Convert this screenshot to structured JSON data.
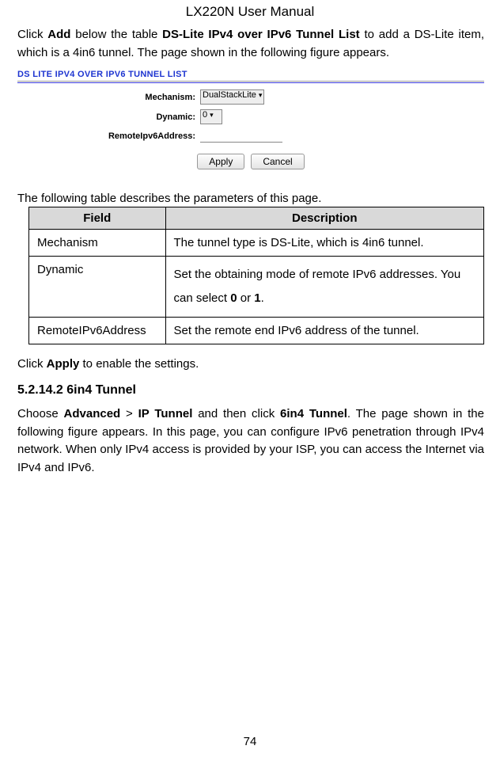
{
  "title": "LX220N User Manual",
  "intro": {
    "part1": "Click ",
    "bold1": "Add",
    "part2": " below the table ",
    "bold2": "DS-Lite IPv4 over IPv6 Tunnel List",
    "part3": " to add a DS-Lite item, which is a 4in6 tunnel. The page shown in the following figure appears."
  },
  "screenshot": {
    "header": "DS LITE IPV4 OVER IPV6 TUNNEL LIST",
    "labels": {
      "mechanism": "Mechanism:",
      "dynamic": "Dynamic:",
      "remote": "RemoteIpv6Address:"
    },
    "values": {
      "mechanism": "DualStackLite",
      "dynamic": "0"
    },
    "buttons": {
      "apply": "Apply",
      "cancel": "Cancel"
    }
  },
  "param_intro": "The following table describes the parameters of this page.",
  "param_headers": {
    "field": "Field",
    "description": "Description"
  },
  "param_rows": {
    "r1_field": "Mechanism",
    "r1_desc": "The tunnel type is DS-Lite, which is 4in6 tunnel.",
    "r2_field": "Dynamic",
    "r2_desc_p1": "Set the obtaining mode of remote IPv6 addresses. You can select ",
    "r2_desc_b1": "0",
    "r2_desc_p2": " or ",
    "r2_desc_b2": "1",
    "r2_desc_p3": ".",
    "r3_field": "RemoteIPv6Address",
    "r3_desc": "Set the remote end IPv6 address of the tunnel."
  },
  "apply_line": {
    "p1": "Click ",
    "b1": "Apply",
    "p2": " to enable the settings."
  },
  "section": {
    "number": "5.2.14.2",
    "title": "6in4 Tunnel"
  },
  "section_para": {
    "p1": "Choose ",
    "b1": "Advanced",
    "p2": " > ",
    "b2": "IP Tunnel",
    "p3": " and then click ",
    "b3": "6in4 Tunnel",
    "p4": ". The page shown in the following figure appears. In this page, you can configure IPv6 penetration through IPv4 network. When only IPv4 access is provided by your ISP, you can access the Internet via IPv4 and IPv6."
  },
  "page_number": "74"
}
